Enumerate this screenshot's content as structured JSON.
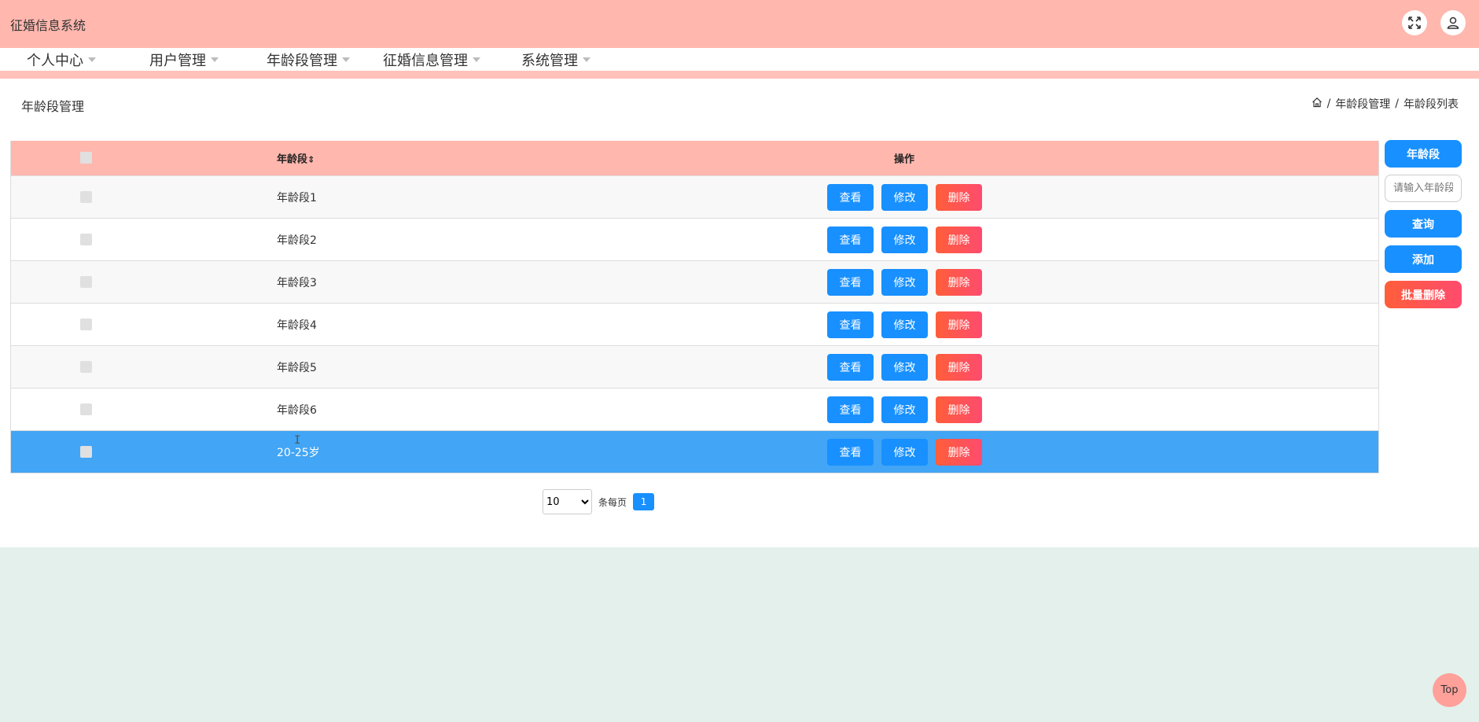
{
  "app": {
    "title": "征婚信息系统"
  },
  "top_icons": [
    "expand-icon",
    "user-icon"
  ],
  "nav": [
    {
      "label": "个人中心"
    },
    {
      "label": "用户管理"
    },
    {
      "label": "年龄段管理"
    },
    {
      "label": "征婚信息管理"
    },
    {
      "label": "系统管理"
    }
  ],
  "page": {
    "title": "年龄段管理",
    "breadcrumb": [
      "年龄段管理",
      "年龄段列表"
    ]
  },
  "table": {
    "headers": {
      "age": "年龄段",
      "sort_icon": "⇕",
      "ops": "操作"
    },
    "rows": [
      {
        "age": "年龄段1"
      },
      {
        "age": "年龄段2"
      },
      {
        "age": "年龄段3"
      },
      {
        "age": "年龄段4"
      },
      {
        "age": "年龄段5"
      },
      {
        "age": "年龄段6"
      },
      {
        "age": "20-25岁",
        "selected": true
      }
    ],
    "actions": {
      "view": "查看",
      "edit": "修改",
      "delete": "删除"
    }
  },
  "sidebar": {
    "label_button": "年龄段",
    "search_placeholder": "请输入年龄段",
    "query": "查询",
    "add": "添加",
    "batch_delete": "批量删除"
  },
  "pagination": {
    "page_size": "10",
    "page_size_options": [
      "10"
    ],
    "per_page_label": "条每页",
    "current_page": "1"
  },
  "back_to_top": "Top",
  "colors": {
    "header_bg": "#ffb7ae",
    "primary": "#1890ff",
    "danger": "#ff5e3a",
    "selected_row": "#42a5f5",
    "footer_bg": "#e3f0eb"
  }
}
